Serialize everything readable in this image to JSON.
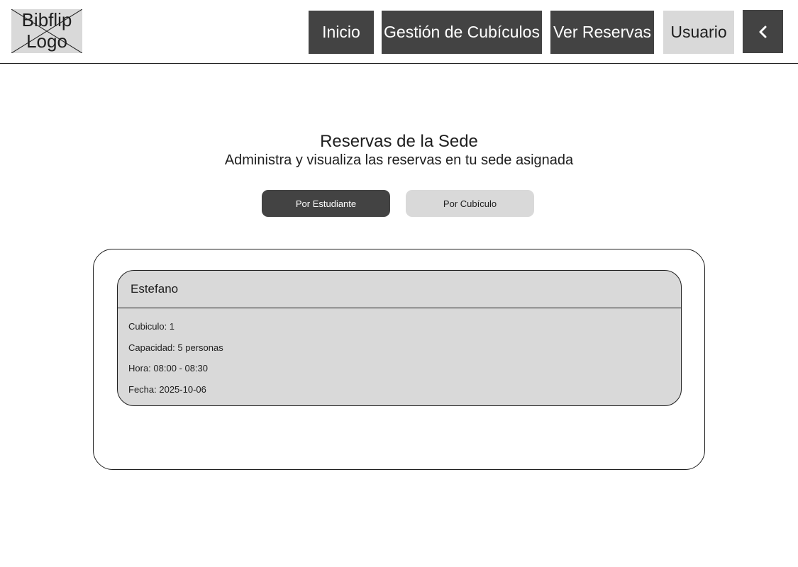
{
  "header": {
    "logo_text": "Bibflip Logo",
    "nav": {
      "inicio": "Inicio",
      "gestion": "Gestión de Cubículos",
      "reservas": "Ver Reservas",
      "usuario": "Usuario"
    },
    "back_icon": "chevron-left-icon"
  },
  "main": {
    "title": "Reservas de la Sede",
    "subtitle": "Administra y visualiza las reservas en tu sede asignada",
    "tabs": {
      "student": "Por Estudiante",
      "cubicle": "Por Cubículo"
    },
    "reservation": {
      "name": "Estefano",
      "cubicle": "Cubiculo: 1",
      "capacity": "Capacidad: 5 personas",
      "time": "Hora: 08:00 - 08:30",
      "date": "Fecha: 2025-10-06"
    }
  },
  "colors": {
    "dark": "#434343",
    "light": "#d9d9d9",
    "text": "#1e1e1e"
  }
}
